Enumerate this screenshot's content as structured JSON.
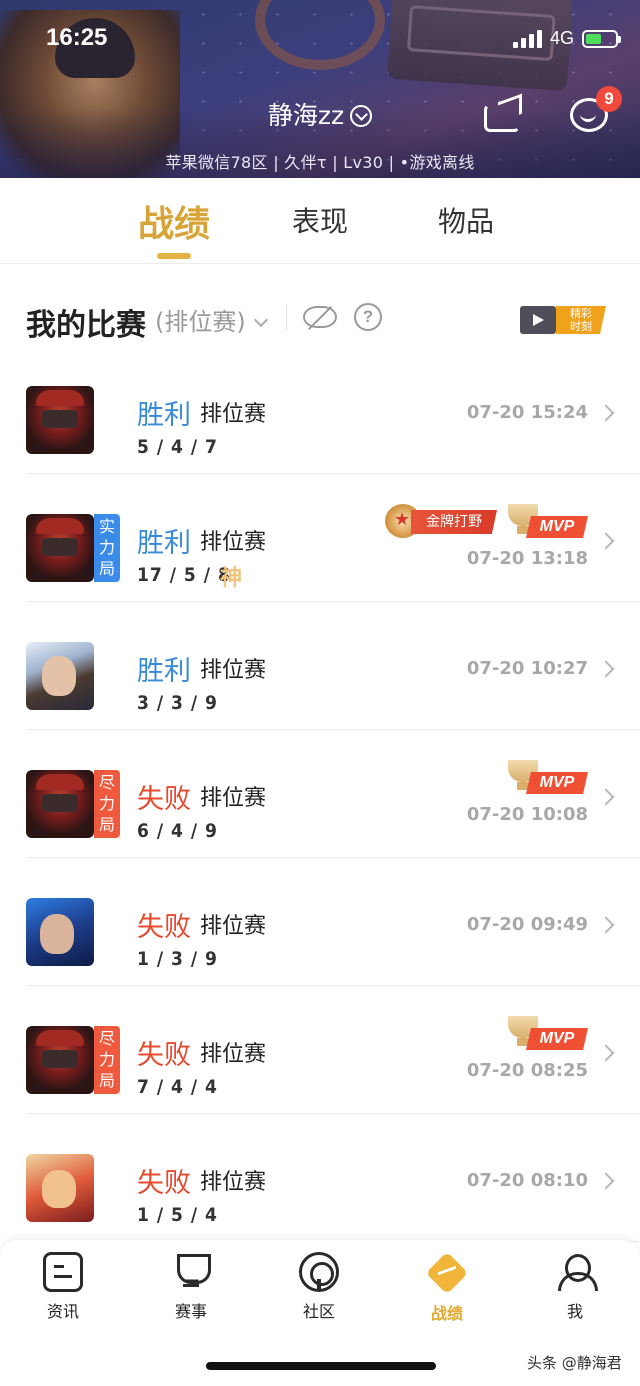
{
  "status_bar": {
    "time": "16:25",
    "network": "4G"
  },
  "profile": {
    "name": "静海zz",
    "sub": "苹果微信78区 | 久伴τ | Lv30 | •游戏离线",
    "message_badge": "9"
  },
  "tabs": [
    {
      "label": "战绩",
      "active": true
    },
    {
      "label": "表现",
      "active": false
    },
    {
      "label": "物品",
      "active": false
    }
  ],
  "section": {
    "title": "我的比赛",
    "filter": "(排位赛)",
    "highlight_label_1": "精彩",
    "highlight_label_2": "时刻"
  },
  "matches": [
    {
      "result": "胜利",
      "result_type": "win",
      "mode": "排位赛",
      "kda": "5 / 4 / 7",
      "time": "07-20 15:24",
      "avatar": "av-red",
      "tag": "",
      "mvp": "",
      "gold_badge": "",
      "god": ""
    },
    {
      "result": "胜利",
      "result_type": "win",
      "mode": "排位赛",
      "kda": "17 / 5 / 8",
      "time": "07-20 13:18",
      "avatar": "av-red",
      "tag": "实力局",
      "tag_color": "blue",
      "mvp": "MVP",
      "gold_badge": "金牌打野",
      "god": "神"
    },
    {
      "result": "胜利",
      "result_type": "win",
      "mode": "排位赛",
      "kda": "3 / 3 / 9",
      "time": "07-20 10:27",
      "avatar": "av-blue1",
      "tag": "",
      "mvp": "",
      "gold_badge": "",
      "god": ""
    },
    {
      "result": "失败",
      "result_type": "lose",
      "mode": "排位赛",
      "kda": "6 / 4 / 9",
      "time": "07-20 10:08",
      "avatar": "av-red",
      "tag": "尽力局",
      "tag_color": "red",
      "mvp": "MVP",
      "gold_badge": "",
      "god": ""
    },
    {
      "result": "失败",
      "result_type": "lose",
      "mode": "排位赛",
      "kda": "1 / 3 / 9",
      "time": "07-20 09:49",
      "avatar": "av-blue2",
      "tag": "",
      "mvp": "",
      "gold_badge": "",
      "god": ""
    },
    {
      "result": "失败",
      "result_type": "lose",
      "mode": "排位赛",
      "kda": "7 / 4 / 4",
      "time": "07-20 08:25",
      "avatar": "av-red",
      "tag": "尽力局",
      "tag_color": "red",
      "mvp": "MVP",
      "gold_badge": "",
      "god": ""
    },
    {
      "result": "失败",
      "result_type": "lose",
      "mode": "排位赛",
      "kda": "1 / 5 / 4",
      "time": "07-20 08:10",
      "avatar": "av-monk",
      "tag": "",
      "mvp": "",
      "gold_badge": "",
      "god": ""
    }
  ],
  "bottom_nav": [
    {
      "label": "资讯",
      "icon": "news-icon",
      "active": false
    },
    {
      "label": "赛事",
      "icon": "trophy-icon",
      "active": false
    },
    {
      "label": "社区",
      "icon": "community-icon",
      "active": false
    },
    {
      "label": "战绩",
      "icon": "stats-icon",
      "active": true
    },
    {
      "label": "我",
      "icon": "me-icon",
      "active": false
    }
  ],
  "watermark": "头条 @静海君",
  "colors": {
    "accent": "#e0a930",
    "win": "#3a8bd8",
    "lose": "#e54a2f"
  }
}
